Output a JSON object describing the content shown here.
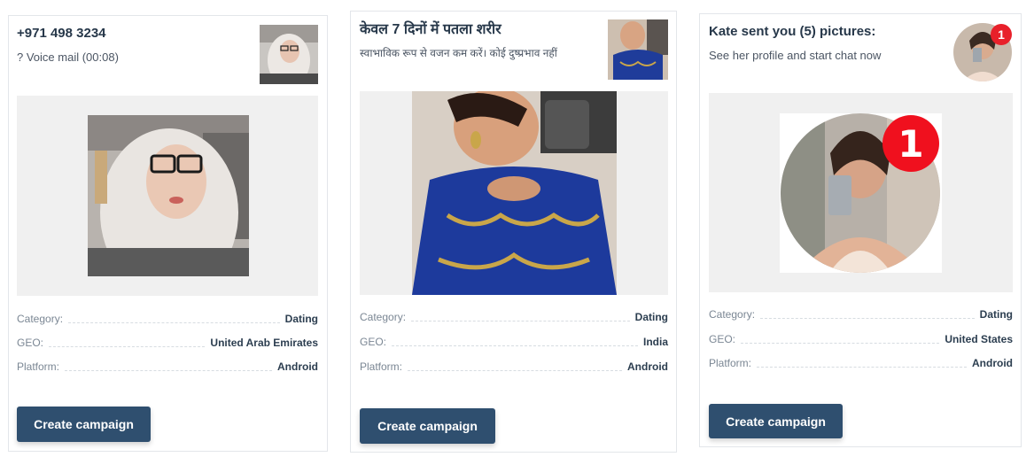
{
  "cards": [
    {
      "title": "+971 498 3234",
      "subtitle": "? Voice mail (00:08)",
      "meta": [
        {
          "key": "Category:",
          "value": "Dating"
        },
        {
          "key": "GEO:",
          "value": "United Arab Emirates"
        },
        {
          "key": "Platform:",
          "value": "Android"
        }
      ],
      "button_label": "Create campaign"
    },
    {
      "title": "केवल 7 दिनों में पतला शरीर",
      "subtitle": "स्वाभाविक रूप से वजन कम करें। कोई दुष्प्रभाव नहीं",
      "meta": [
        {
          "key": "Category:",
          "value": "Dating"
        },
        {
          "key": "GEO:",
          "value": "India"
        },
        {
          "key": "Platform:",
          "value": "Android"
        }
      ],
      "button_label": "Create campaign"
    },
    {
      "title": "Kate sent you (5) pictures:",
      "subtitle": "See her profile and start chat now",
      "badge": "1",
      "meta": [
        {
          "key": "Category:",
          "value": "Dating"
        },
        {
          "key": "GEO:",
          "value": "United States"
        },
        {
          "key": "Platform:",
          "value": "Android"
        }
      ],
      "button_label": "Create campaign"
    }
  ]
}
